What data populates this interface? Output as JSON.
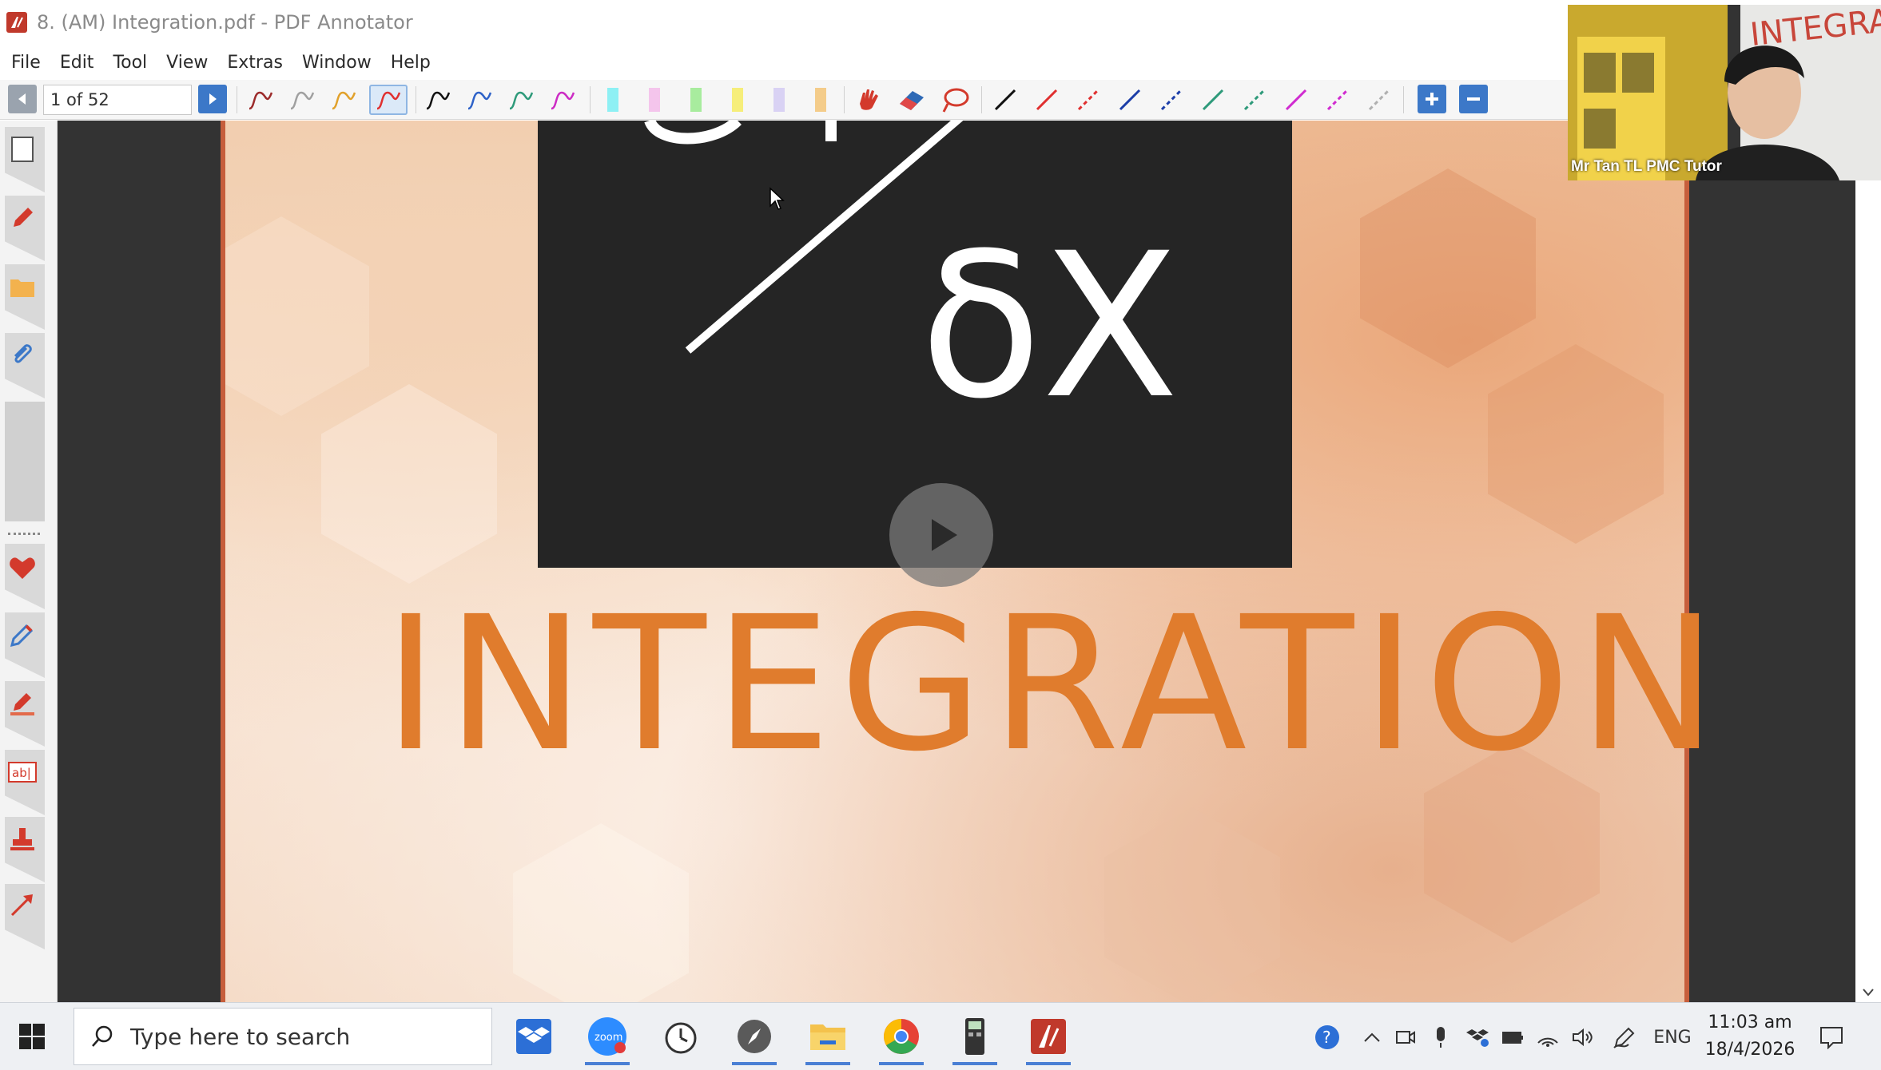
{
  "window": {
    "title": "8. (AM) Integration.pdf - PDF Annotator"
  },
  "menu": {
    "items": [
      "File",
      "Edit",
      "Tool",
      "View",
      "Extras",
      "Window",
      "Help"
    ]
  },
  "toolbar": {
    "page_indicator": "1 of 52"
  },
  "document": {
    "video_text": "δX",
    "heading": "INTEGRATION"
  },
  "webcam": {
    "label": "Mr Tan TL PMC Tutor",
    "background_text": "INTEGRA"
  },
  "taskbar": {
    "search_placeholder": "Type here to search",
    "language": "ENG",
    "time": "11:03 am",
    "date": "18/4/2026"
  },
  "colors": {
    "heading": "#e07c2d",
    "page_border": "#c65e3c",
    "accent_blue": "#3c78c8"
  }
}
